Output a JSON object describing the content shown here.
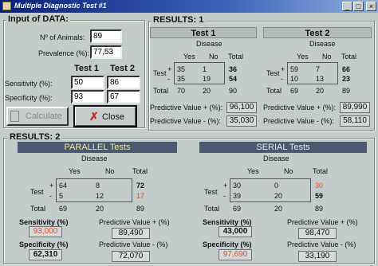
{
  "window": {
    "title": "Multiple Diagnostic Test  #1",
    "minimize": "_",
    "maximize": "□",
    "close": "×"
  },
  "input": {
    "title": "Input of DATA:",
    "animals_label": "Nº of Animals:",
    "animals": "89",
    "prevalence_label": "Prevalence (%):",
    "prevalence": "77,53",
    "test1_header": "Test 1",
    "test2_header": "Test 2",
    "sensitivity_label": "Sensitivity (%):",
    "sens1": "50",
    "sens2": "86",
    "specificity_label": "Specificity (%):",
    "spec1": "93",
    "spec2": "67",
    "calculate_label": "Calculate",
    "close_label": "Close"
  },
  "results1": {
    "title": "RESULTS:  1",
    "tests": [
      {
        "name": "Test 1",
        "disease": "Disease",
        "yes": "Yes",
        "no": "No",
        "total": "Total",
        "row_label": "Test",
        "plus": "+",
        "minus": "-",
        "total_row": "Total",
        "r1": [
          "35",
          "1",
          "36"
        ],
        "r2": [
          "35",
          "19",
          "54"
        ],
        "rt": [
          "70",
          "20",
          "90"
        ],
        "ppv_label": "Predictive Value + (%):",
        "ppv": "96,100",
        "npv_label": "Predictive Value - (%):",
        "npv": "35,030"
      },
      {
        "name": "Test 2",
        "disease": "Disease",
        "yes": "Yes",
        "no": "No",
        "total": "Total",
        "row_label": "Test",
        "plus": "+",
        "minus": "-",
        "total_row": "Total",
        "r1": [
          "59",
          "7",
          "66"
        ],
        "r2": [
          "10",
          "13",
          "23"
        ],
        "rt": [
          "69",
          "20",
          "89"
        ],
        "ppv_label": "Predictive Value + (%):",
        "ppv": "89,990",
        "npv_label": "Predictive Value - (%):",
        "npv": "58,110"
      }
    ]
  },
  "results2": {
    "title": "RESULTS:  2",
    "parallel": {
      "name": "PARALLEL Tests",
      "disease": "Disease",
      "yes": "Yes",
      "no": "No",
      "total": "Total",
      "row_label": "Test",
      "plus": "+",
      "minus": "-",
      "total_row": "Total",
      "r1": [
        "64",
        "8",
        "72"
      ],
      "r2": [
        "5",
        "12",
        "17"
      ],
      "rt": [
        "69",
        "20",
        "89"
      ],
      "sens_label": "Sensitivity (%)",
      "sens": "93,000",
      "spec_label": "Specificity (%)",
      "spec": "62,310",
      "ppv_label": "Predictive Value + (%)",
      "ppv": "89,490",
      "npv_label": "Predictive Value - (%)",
      "npv": "72,070"
    },
    "serial": {
      "name": "SERIAL Tests",
      "disease": "Disease",
      "yes": "Yes",
      "no": "No",
      "total": "Total",
      "row_label": "Test",
      "plus": "+",
      "minus": "-",
      "total_row": "Total",
      "r1": [
        "30",
        "0",
        "30"
      ],
      "r2": [
        "39",
        "20",
        "59"
      ],
      "rt": [
        "69",
        "20",
        "89"
      ],
      "sens_label": "Sensitivity (%)",
      "sens": "43,000",
      "spec_label": "Specificity (%)",
      "spec": "97,690",
      "ppv_label": "Predictive Value + (%)",
      "ppv": "98,470",
      "npv_label": "Predictive Value - (%)",
      "npv": "33,190"
    }
  },
  "colors": {
    "header_bar": "#4a5870",
    "header_text": "#f0e890",
    "serial_text": "#e8e8e8",
    "highlight": "#e05030"
  }
}
